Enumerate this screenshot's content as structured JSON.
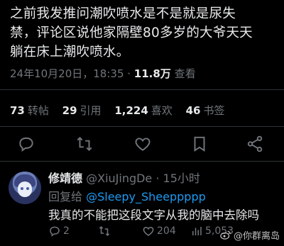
{
  "tweet": {
    "line1": "之前我发推问潮吹喷水是不是就是尿失",
    "line2": "禁，评论区说他家隔壁80多岁的大爷天天",
    "line3": "躺在床上潮吹喷水。",
    "timestamp": "24年10月20日，18:35 · ",
    "views_count": "11.8万",
    "views_label": " 查看"
  },
  "stats": {
    "retweets_count": "73",
    "retweets_label": "转帖",
    "quotes_count": "29",
    "quotes_label": "引用",
    "likes_count": "1,224",
    "likes_label": "喜欢",
    "bookmarks_count": "46",
    "bookmarks_label": "书签"
  },
  "reply": {
    "name": "修靖德",
    "handle": " @XiuJingDe · 15小时",
    "reply_to_prefix": "回复给 ",
    "reply_to_mention": "@Sleepy_Sheeppppp",
    "text": "我真的不能把这段文字从我的脑中去除吗",
    "replies_count": "2",
    "likes_count": "204",
    "views_count": "5,053"
  },
  "watermark": {
    "text": "@你群离岛"
  },
  "colors": {
    "background": "#000000",
    "text": "#e7e9ea",
    "muted": "#71767b",
    "accent": "#1d9bf0",
    "divider": "#2f3336"
  }
}
